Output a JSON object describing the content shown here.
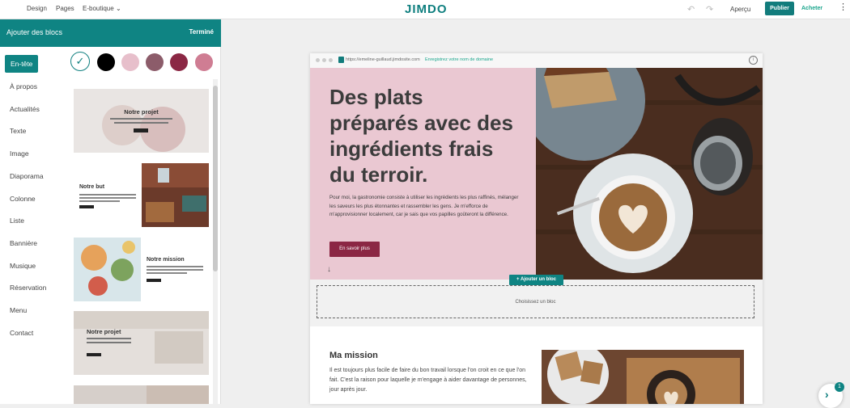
{
  "topbar": {
    "nav": [
      "Design",
      "Pages",
      "E-boutique"
    ],
    "logo": "JIMDO",
    "preview": "Aperçu",
    "publish": "Publier",
    "buy": "Acheter"
  },
  "panel": {
    "title": "Ajouter des blocs",
    "done": "Terminé",
    "categories": [
      "En-tête",
      "À propos",
      "Actualités",
      "Texte",
      "Image",
      "Diaporama",
      "Colonne",
      "Liste",
      "Bannière",
      "Musique",
      "Réservation",
      "Menu",
      "Contact"
    ],
    "active_category": "En-tête",
    "swatch_colors": [
      "#000000",
      "#e7bfcb",
      "#8c5c6a",
      "#8b2744",
      "#cf7d93"
    ],
    "thumbnails": [
      "Notre projet",
      "Notre but",
      "Notre mission",
      "Notre projet"
    ]
  },
  "browser": {
    "url": "https://emeline-guillaud.jimdosite.com",
    "url_link": "Enregistrez votre nom de domaine"
  },
  "hero": {
    "title": "Des plats préparés avec des ingrédients frais du terroir.",
    "text": "Pour moi, la gastronomie consiste à utiliser les ingrédients les plus raffinés, mélanger les saveurs les plus étonnantes et rassembler les gens. Je m'efforce de m'approvisionner localement, car je sais que vos papilles goûteront la différence.",
    "button": "En savoir plus"
  },
  "add_block": "Ajouter un bloc",
  "choose_block": "Choisissez un bloc",
  "mission": {
    "title": "Ma mission",
    "text": "Il est toujours plus facile de faire du bon travail lorsque l'on croit en ce que l'on fait. C'est la raison pour laquelle je m'engage à aider davantage de personnes, jour après jour."
  },
  "chat": {
    "badge": "1"
  },
  "colors": {
    "teal": "#0f8483",
    "brand": "#127c7c",
    "hero_bg": "#eac8d2",
    "button": "#8b2744"
  }
}
